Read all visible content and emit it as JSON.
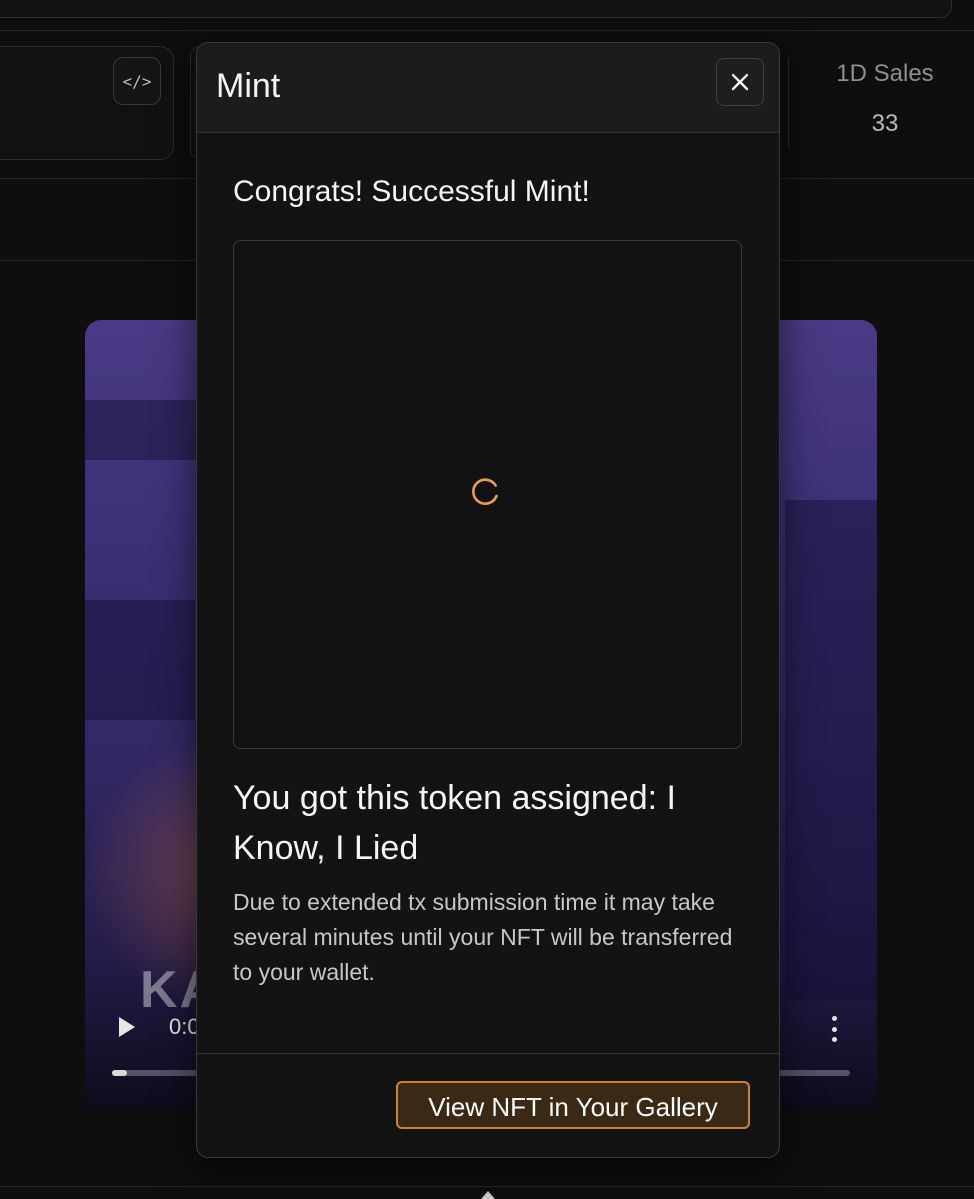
{
  "background": {
    "code_button_label": "</>",
    "stats": {
      "sales_label": "1D Sales",
      "sales_value": "33"
    },
    "video": {
      "time": "0:0",
      "logo_text": "KA",
      "progress_fraction": 0.02
    }
  },
  "modal": {
    "title": "Mint",
    "congrats": "Congrats! Successful Mint!",
    "assigned_text": "You got this token assigned: I Know, I Lied",
    "note": "Due to extended tx submission time it may take several minutes until your NFT will be transferred to your wallet.",
    "gallery_button": "View NFT in Your Gallery",
    "colors": {
      "accent": "#e8a33a",
      "button_border": "#c8872c",
      "button_fill": "#3a2a15"
    },
    "icons": [
      "close-icon",
      "loading-spinner-icon"
    ]
  }
}
